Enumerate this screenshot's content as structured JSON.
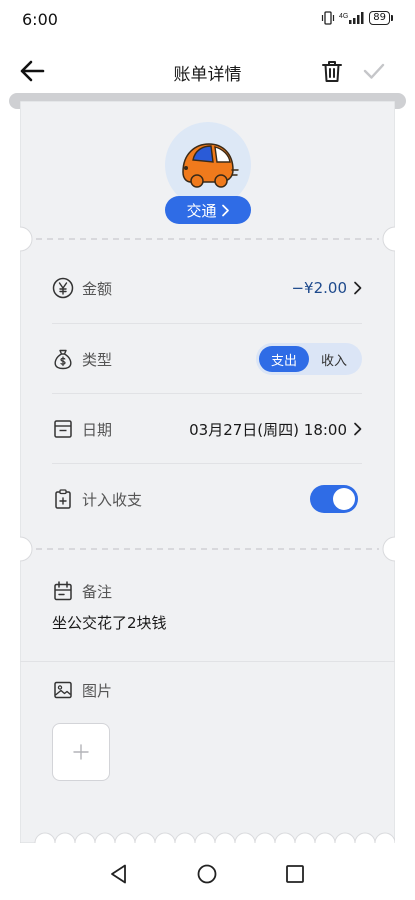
{
  "status_bar": {
    "time": "6:00",
    "battery": "89",
    "network": "4G"
  },
  "header": {
    "title": "账单详情"
  },
  "category": {
    "label": "交通",
    "icon": "car-icon"
  },
  "fields": {
    "amount": {
      "label": "金额",
      "value": "−¥2.00",
      "icon": "yen-icon"
    },
    "type": {
      "label": "类型",
      "options": [
        "支出",
        "收入"
      ],
      "selected": "支出",
      "icon": "money-bag-icon"
    },
    "date": {
      "label": "日期",
      "value": "03月27日(周四) 18:00",
      "icon": "calendar-icon"
    },
    "include": {
      "label": "计入收支",
      "enabled": true,
      "icon": "clipboard-icon"
    }
  },
  "note": {
    "label": "备注",
    "text": "坐公交花了2块钱"
  },
  "photo": {
    "label": "图片"
  },
  "colors": {
    "accent": "#2f6ce6",
    "amount": "#1e4a8c",
    "card": "#f0f1f3"
  }
}
